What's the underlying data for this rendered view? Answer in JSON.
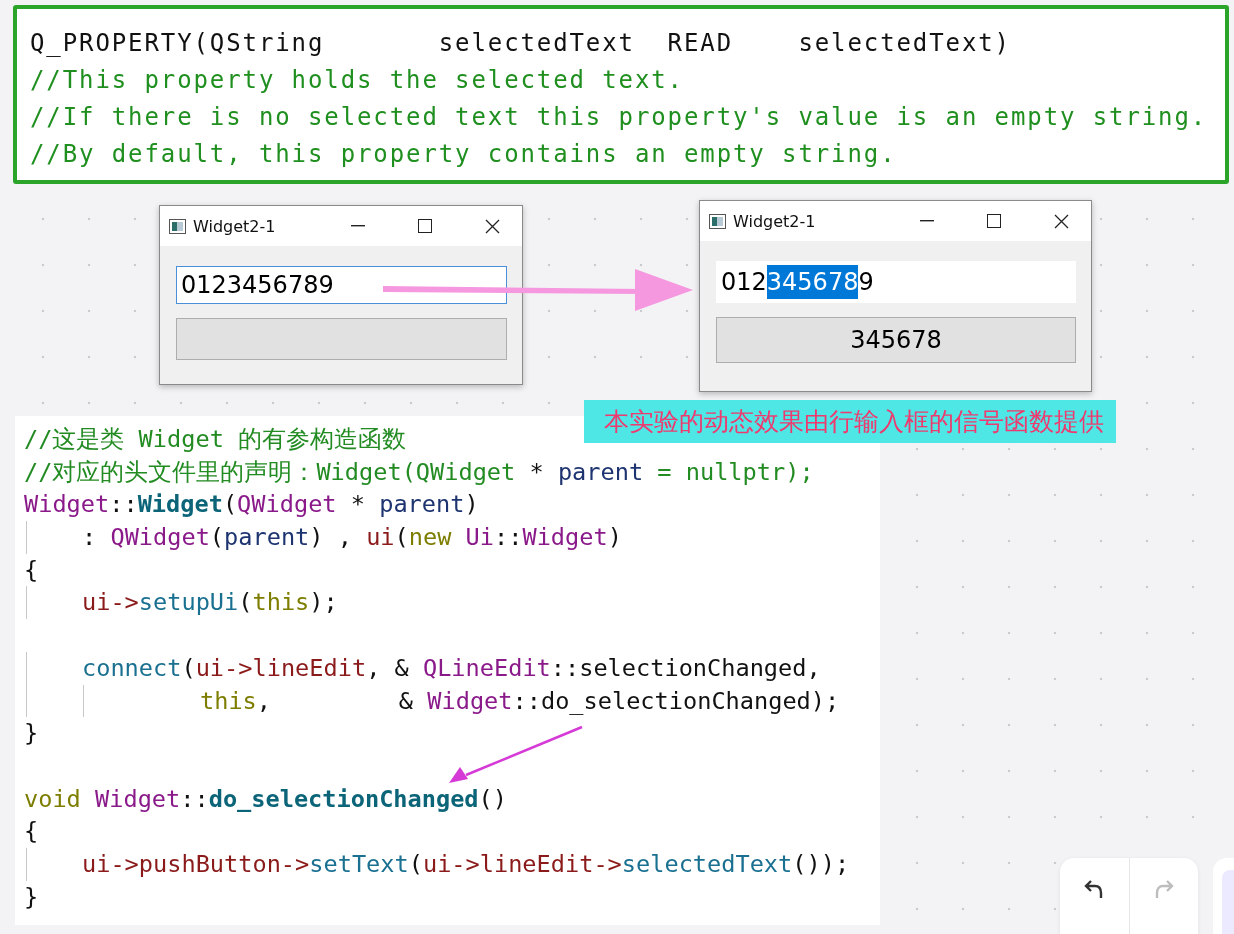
{
  "property_note": {
    "lines": [
      {
        "kind": "code",
        "text": "Q_PROPERTY(QString       selectedText  READ    selectedText)"
      },
      {
        "kind": "comment",
        "text": "//This property holds the selected text."
      },
      {
        "kind": "comment",
        "text": "//If there is no selected text this property's value is an empty string."
      },
      {
        "kind": "comment",
        "text": "//By default, this property contains an empty string."
      }
    ]
  },
  "windows": [
    {
      "title": "Widget2-1",
      "field": {
        "focused": true,
        "segments": [
          {
            "text": "0123456789",
            "selected": false
          }
        ]
      },
      "button": {
        "kind": "empty"
      }
    },
    {
      "title": "Widget2-1",
      "field": {
        "focused": false,
        "segments": [
          {
            "text": "012",
            "selected": false
          },
          {
            "text": "345678",
            "selected": true
          },
          {
            "text": "9",
            "selected": false
          }
        ]
      },
      "button": {
        "kind": "label",
        "label": "345678"
      }
    }
  ],
  "banner": {
    "text": "本实验的动态效果由行输入框的信号函数提供"
  },
  "code": {
    "lines": [
      {
        "kind": "code",
        "tokens": [
          {
            "kind": "comment",
            "text": "//这是类 Widget 的有参构造函数"
          }
        ]
      },
      {
        "kind": "code",
        "tokens": [
          {
            "kind": "comment",
            "text": "//对应的头文件里的声明：Widget(QWidget "
          },
          {
            "kind": "plain",
            "text": "* "
          },
          {
            "kind": "param",
            "text": "parent"
          },
          {
            "kind": "comment",
            "text": " = nullptr);"
          }
        ]
      },
      {
        "kind": "code",
        "tokens": [
          {
            "kind": "type",
            "text": "Widget"
          },
          {
            "kind": "plain",
            "text": "::"
          },
          {
            "kind": "bold",
            "text": "Widget"
          },
          {
            "kind": "plain",
            "text": "("
          },
          {
            "kind": "type",
            "text": "QWidget"
          },
          {
            "kind": "plain",
            "text": " * "
          },
          {
            "kind": "param",
            "text": "parent"
          },
          {
            "kind": "plain",
            "text": ")"
          }
        ]
      },
      {
        "kind": "indent",
        "tokens": [
          {
            "kind": "plain",
            "text": ": "
          },
          {
            "kind": "type",
            "text": "QWidget"
          },
          {
            "kind": "plain",
            "text": "("
          },
          {
            "kind": "param",
            "text": "parent"
          },
          {
            "kind": "plain",
            "text": ") , "
          },
          {
            "kind": "member",
            "text": "ui"
          },
          {
            "kind": "plain",
            "text": "("
          },
          {
            "kind": "keyword",
            "text": "new"
          },
          {
            "kind": "type",
            "text": " Ui"
          },
          {
            "kind": "plain",
            "text": "::"
          },
          {
            "kind": "type",
            "text": "Widget"
          },
          {
            "kind": "plain",
            "text": ")"
          }
        ]
      },
      {
        "kind": "code",
        "tokens": [
          {
            "kind": "plain",
            "text": "{"
          }
        ]
      },
      {
        "kind": "indent",
        "tokens": [
          {
            "kind": "member",
            "text": "ui->"
          },
          {
            "kind": "func",
            "text": "setupUi"
          },
          {
            "kind": "plain",
            "text": "("
          },
          {
            "kind": "keyword",
            "text": "this"
          },
          {
            "kind": "plain",
            "text": ");"
          }
        ]
      },
      {
        "kind": "blank"
      },
      {
        "kind": "indent",
        "tokens": [
          {
            "kind": "func",
            "text": "connect"
          },
          {
            "kind": "plain",
            "text": "("
          },
          {
            "kind": "member",
            "text": "ui->lineEdit"
          },
          {
            "kind": "plain",
            "text": ", & "
          },
          {
            "kind": "type",
            "text": "QLineEdit"
          },
          {
            "kind": "plain",
            "text": "::selectionChanged,"
          }
        ]
      },
      {
        "kind": "continuation",
        "tokens": [
          {
            "kind": "keyword",
            "text": "this"
          },
          {
            "kind": "plain",
            "text": ",         & "
          },
          {
            "kind": "type",
            "text": "Widget"
          },
          {
            "kind": "plain",
            "text": "::do_selectionChanged);"
          }
        ]
      },
      {
        "kind": "code",
        "tokens": [
          {
            "kind": "plain",
            "text": "}"
          }
        ]
      },
      {
        "kind": "blank"
      },
      {
        "kind": "code",
        "tokens": [
          {
            "kind": "keyword",
            "text": "void"
          },
          {
            "kind": "type",
            "text": " Widget"
          },
          {
            "kind": "plain",
            "text": "::"
          },
          {
            "kind": "bold",
            "text": "do_selectionChanged"
          },
          {
            "kind": "plain",
            "text": "()"
          }
        ]
      },
      {
        "kind": "code",
        "tokens": [
          {
            "kind": "plain",
            "text": "{"
          }
        ]
      },
      {
        "kind": "indent",
        "tokens": [
          {
            "kind": "member",
            "text": "ui->pushButton->"
          },
          {
            "kind": "func",
            "text": "setText"
          },
          {
            "kind": "plain",
            "text": "("
          },
          {
            "kind": "member",
            "text": "ui->lineEdit->"
          },
          {
            "kind": "func",
            "text": "selectedText"
          },
          {
            "kind": "plain",
            "text": "());"
          }
        ]
      },
      {
        "kind": "code",
        "tokens": [
          {
            "kind": "plain",
            "text": "}"
          }
        ]
      }
    ]
  },
  "history": {
    "undo": {
      "disabled": false
    },
    "redo": {
      "disabled": true
    }
  }
}
